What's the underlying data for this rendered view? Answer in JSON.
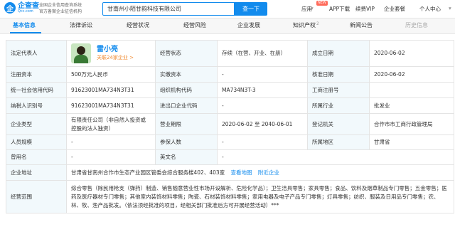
{
  "header": {
    "logo_cn": "企查查",
    "logo_en": "Qcc.com",
    "slogan": [
      "全国企业信用查询系统",
      "官方备案企业征信机构"
    ],
    "search_value": "甘南州小陌甘韵科技有限公司",
    "search_button": "查一下",
    "nav": [
      "应用",
      "APP下载",
      "续费VIP",
      "企业套餐",
      "个人中心"
    ],
    "new_badge": "NEW"
  },
  "tabs": [
    {
      "label": "基本信息",
      "count": "",
      "active": true
    },
    {
      "label": "法律诉讼",
      "count": "",
      "active": false
    },
    {
      "label": "经营状况",
      "count": "",
      "active": false
    },
    {
      "label": "经营风险",
      "count": "",
      "active": false
    },
    {
      "label": "企业发展",
      "count": "",
      "active": false
    },
    {
      "label": "知识产权",
      "count": "2",
      "active": false
    },
    {
      "label": "新闻公告",
      "count": "",
      "active": false
    },
    {
      "label": "历史信息",
      "count": "",
      "active": false
    }
  ],
  "info": {
    "legal_rep_label": "法定代表人",
    "legal_rep_name": "雷小亮",
    "legal_rep_link": "关联24家企业 >",
    "status_label": "经营状态",
    "status_value": "存续（在营、开业、在册）",
    "est_date_label": "成立日期",
    "est_date_value": "2020-06-02",
    "reg_capital_label": "注册资本",
    "reg_capital_value": "500万元人民币",
    "paid_capital_label": "实缴资本",
    "paid_capital_value": "-",
    "approval_date_label": "核准日期",
    "approval_date_value": "2020-06-02",
    "credit_code_label": "统一社会信用代码",
    "credit_code_value": "91623001MA734N3T31",
    "org_code_label": "组织机构代码",
    "org_code_value": "MA734N3T-3",
    "biz_reg_label": "工商注册号",
    "biz_reg_value": "",
    "tax_id_label": "纳税人识别号",
    "tax_id_value": "91623001MA734N3T31",
    "import_export_label": "进出口企业代码",
    "import_export_value": "-",
    "industry_label": "所属行业",
    "industry_value": "批发业",
    "type_label": "企业类型",
    "type_value": "有限责任公司（非自然人投资或控股的法人独资）",
    "term_label": "营业期限",
    "term_value": "2020-06-02 至 2040-06-01",
    "reg_authority_label": "登记机关",
    "reg_authority_value": "合作市市工商行政管理局",
    "staff_label": "人员规模",
    "staff_value": "-",
    "insured_label": "参保人数",
    "insured_value": "-",
    "region_label": "所属地区",
    "region_value": "甘肃省",
    "former_name_label": "曾用名",
    "former_name_value": "-",
    "english_name_label": "英文名",
    "english_name_value": "-",
    "address_label": "企业地址",
    "address_value": "甘肃省甘南州合作市生态产业园区管委会综合服务楼402、403室",
    "address_map_link": "查看地图",
    "address_nearby_link": "附近企业",
    "scope_label": "经营范围",
    "scope_value": "综合零售（除民用枪支（弹药）制造、销售随意营业性市场开设解析、危险化学品）；卫生洁具零售；家具零售；食品、饮料及烟草制品专门零售；五金零售；医药及医疗器材专门零售；其他室内装饰材料零售；陶瓷、石材装饰材料零售；家用电器及电子产品专门零售；灯具零售；纺织、服装及日用品专门零售；农、林、牧、渔产品批发。（依法须经批准的项目，经相关部门批准后方可开展经营活动）***"
  }
}
